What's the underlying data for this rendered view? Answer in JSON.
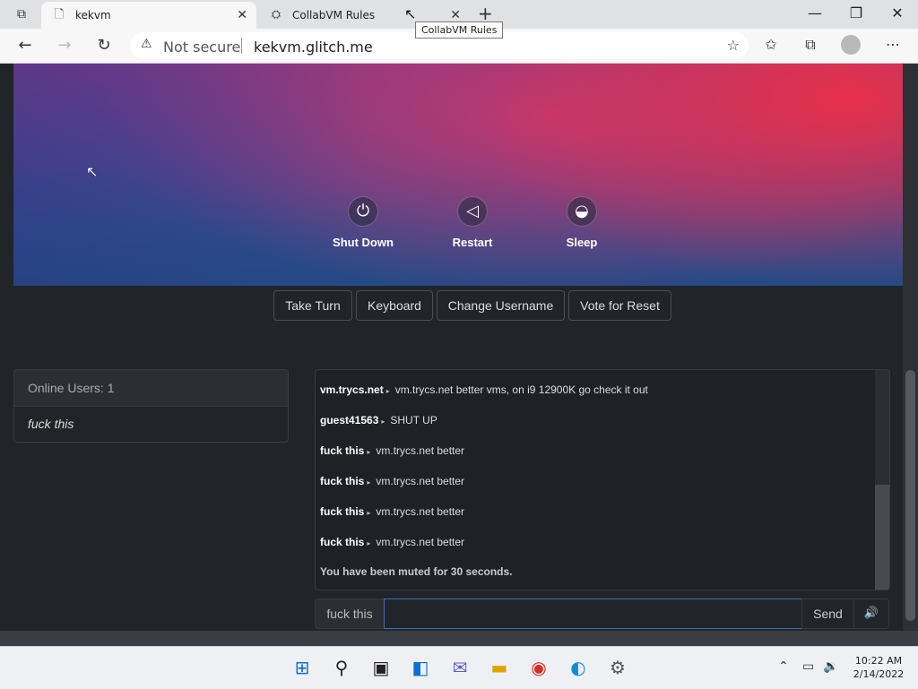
{
  "browser": {
    "tabs": [
      {
        "title": "kekvm",
        "active": true,
        "favicon": "page-icon"
      },
      {
        "title": "CollabVM Rules",
        "active": false,
        "favicon": "collabvm-icon"
      }
    ],
    "tooltip": "CollabVM Rules",
    "security_label": "Not secure",
    "url": "kekvm.glitch.me",
    "window_controls": {
      "minimize": "—",
      "restore": "❐",
      "close": "✕"
    }
  },
  "vm": {
    "power_options": [
      {
        "label": "Shut Down",
        "icon": "power-icon"
      },
      {
        "label": "Restart",
        "icon": "restart-icon"
      },
      {
        "label": "Sleep",
        "icon": "sleep-icon"
      }
    ],
    "controls": [
      "Take Turn",
      "Keyboard",
      "Change Username",
      "Vote for Reset"
    ]
  },
  "users": {
    "header": "Online Users: 1",
    "list": [
      "fuck this"
    ]
  },
  "chat": {
    "messages": [
      {
        "user": "vm.trycs.net",
        "text": "vm.trycs.net better vms, on i9 12900K go check it out"
      },
      {
        "user": "guest41563",
        "text": "SHUT UP"
      },
      {
        "user": "fuck this",
        "text": "vm.trycs.net better"
      },
      {
        "user": "fuck this",
        "text": "vm.trycs.net better"
      },
      {
        "user": "fuck this",
        "text": "vm.trycs.net better"
      },
      {
        "user": "fuck this",
        "text": "vm.trycs.net better"
      }
    ],
    "system_message": "You have been muted for 30 seconds.",
    "input": {
      "username": "fuck this",
      "value": "",
      "send_label": "Send"
    }
  },
  "taskbar": {
    "time": "10:22 AM",
    "date": "2/14/2022"
  }
}
